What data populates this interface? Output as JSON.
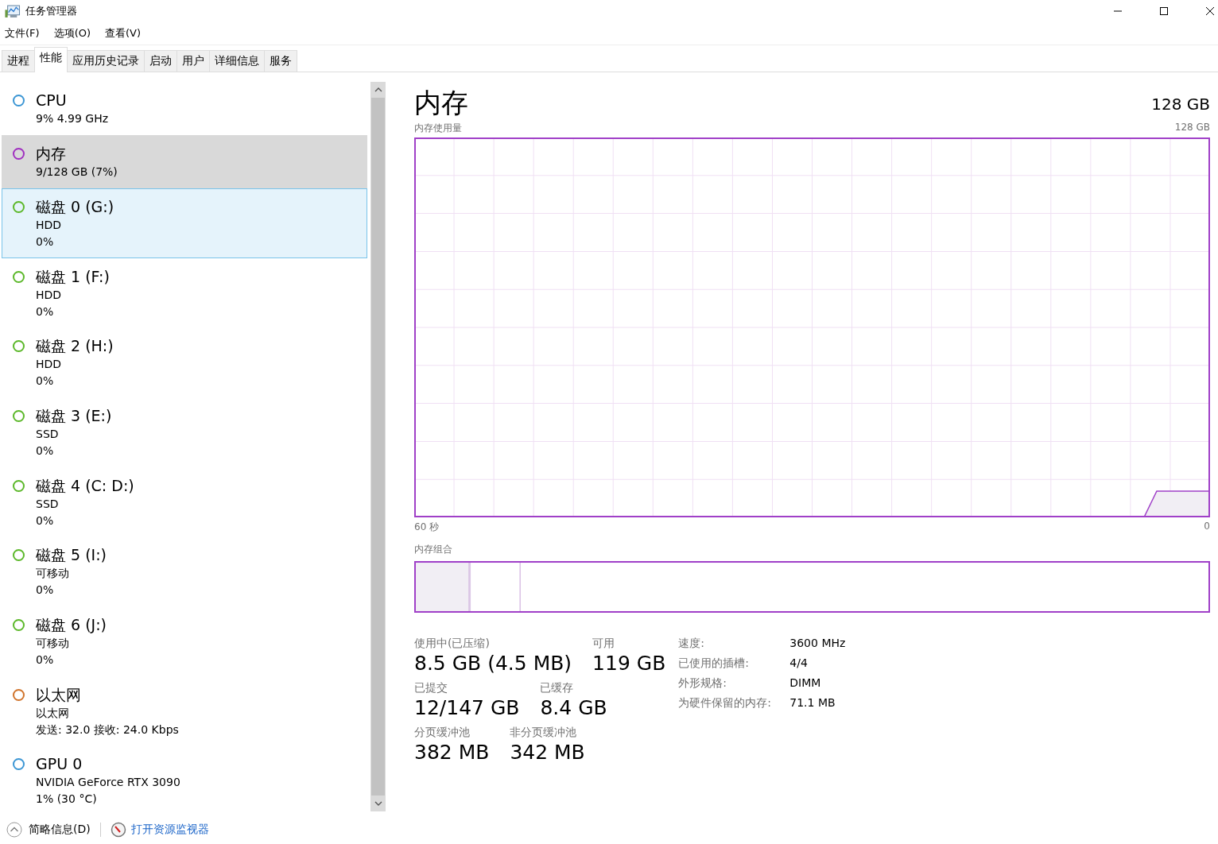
{
  "window": {
    "title": "任务管理器"
  },
  "menu": [
    "文件(F)",
    "选项(O)",
    "查看(V)"
  ],
  "tabs": [
    {
      "label": "进程",
      "selected": false
    },
    {
      "label": "性能",
      "selected": true
    },
    {
      "label": "应用历史记录",
      "selected": false
    },
    {
      "label": "启动",
      "selected": false
    },
    {
      "label": "用户",
      "selected": false
    },
    {
      "label": "详细信息",
      "selected": false
    },
    {
      "label": "服务",
      "selected": false
    }
  ],
  "sidebar": {
    "items": [
      {
        "name": "CPU",
        "lines": [
          "9% 4.99 GHz"
        ],
        "color": "#3c96d4",
        "selected": false,
        "hovered": false
      },
      {
        "name": "内存",
        "lines": [
          "9/128 GB (7%)"
        ],
        "color": "#a030c0",
        "selected": true,
        "hovered": false
      },
      {
        "name": "磁盘 0 (G:)",
        "lines": [
          "HDD",
          "0%"
        ],
        "color": "#5cb82a",
        "selected": false,
        "hovered": true
      },
      {
        "name": "磁盘 1 (F:)",
        "lines": [
          "HDD",
          "0%"
        ],
        "color": "#5cb82a",
        "selected": false,
        "hovered": false
      },
      {
        "name": "磁盘 2 (H:)",
        "lines": [
          "HDD",
          "0%"
        ],
        "color": "#5cb82a",
        "selected": false,
        "hovered": false
      },
      {
        "name": "磁盘 3 (E:)",
        "lines": [
          "SSD",
          "0%"
        ],
        "color": "#5cb82a",
        "selected": false,
        "hovered": false
      },
      {
        "name": "磁盘 4 (C: D:)",
        "lines": [
          "SSD",
          "0%"
        ],
        "color": "#5cb82a",
        "selected": false,
        "hovered": false
      },
      {
        "name": "磁盘 5 (I:)",
        "lines": [
          "可移动",
          "0%"
        ],
        "color": "#5cb82a",
        "selected": false,
        "hovered": false
      },
      {
        "name": "磁盘 6 (J:)",
        "lines": [
          "可移动",
          "0%"
        ],
        "color": "#5cb82a",
        "selected": false,
        "hovered": false
      },
      {
        "name": "以太网",
        "lines": [
          "以太网",
          "发送: 32.0 接收: 24.0 Kbps"
        ],
        "color": "#d0742c",
        "selected": false,
        "hovered": false
      },
      {
        "name": "GPU 0",
        "lines": [
          "NVIDIA GeForce RTX 3090",
          "1% (30 °C)"
        ],
        "color": "#3c96d4",
        "selected": false,
        "hovered": false
      }
    ]
  },
  "panel": {
    "title": "内存",
    "total": "128 GB",
    "usage_graph": {
      "label": "内存使用量",
      "max_label": "128 GB",
      "x_start": "60 秒",
      "x_end": "0"
    },
    "composition_label": "内存组合",
    "stats": [
      [
        {
          "label": "使用中(已压缩)",
          "value": "8.5 GB (4.5 MB)"
        },
        {
          "label": "可用",
          "value": "119 GB"
        }
      ],
      [
        {
          "label": "已提交",
          "value": "12/147 GB"
        },
        {
          "label": "已缓存",
          "value": "8.4 GB"
        }
      ],
      [
        {
          "label": "分页缓冲池",
          "value": "382 MB"
        },
        {
          "label": "非分页缓冲池",
          "value": "342 MB"
        }
      ]
    ],
    "details": [
      {
        "label": "速度:",
        "value": "3600 MHz"
      },
      {
        "label": "已使用的插槽:",
        "value": "4/4"
      },
      {
        "label": "外形规格:",
        "value": "DIMM"
      },
      {
        "label": "为硬件保留的内存:",
        "value": "71.1 MB"
      }
    ]
  },
  "footer": {
    "summary": "简略信息(D)",
    "link": "打开资源监视器"
  }
}
